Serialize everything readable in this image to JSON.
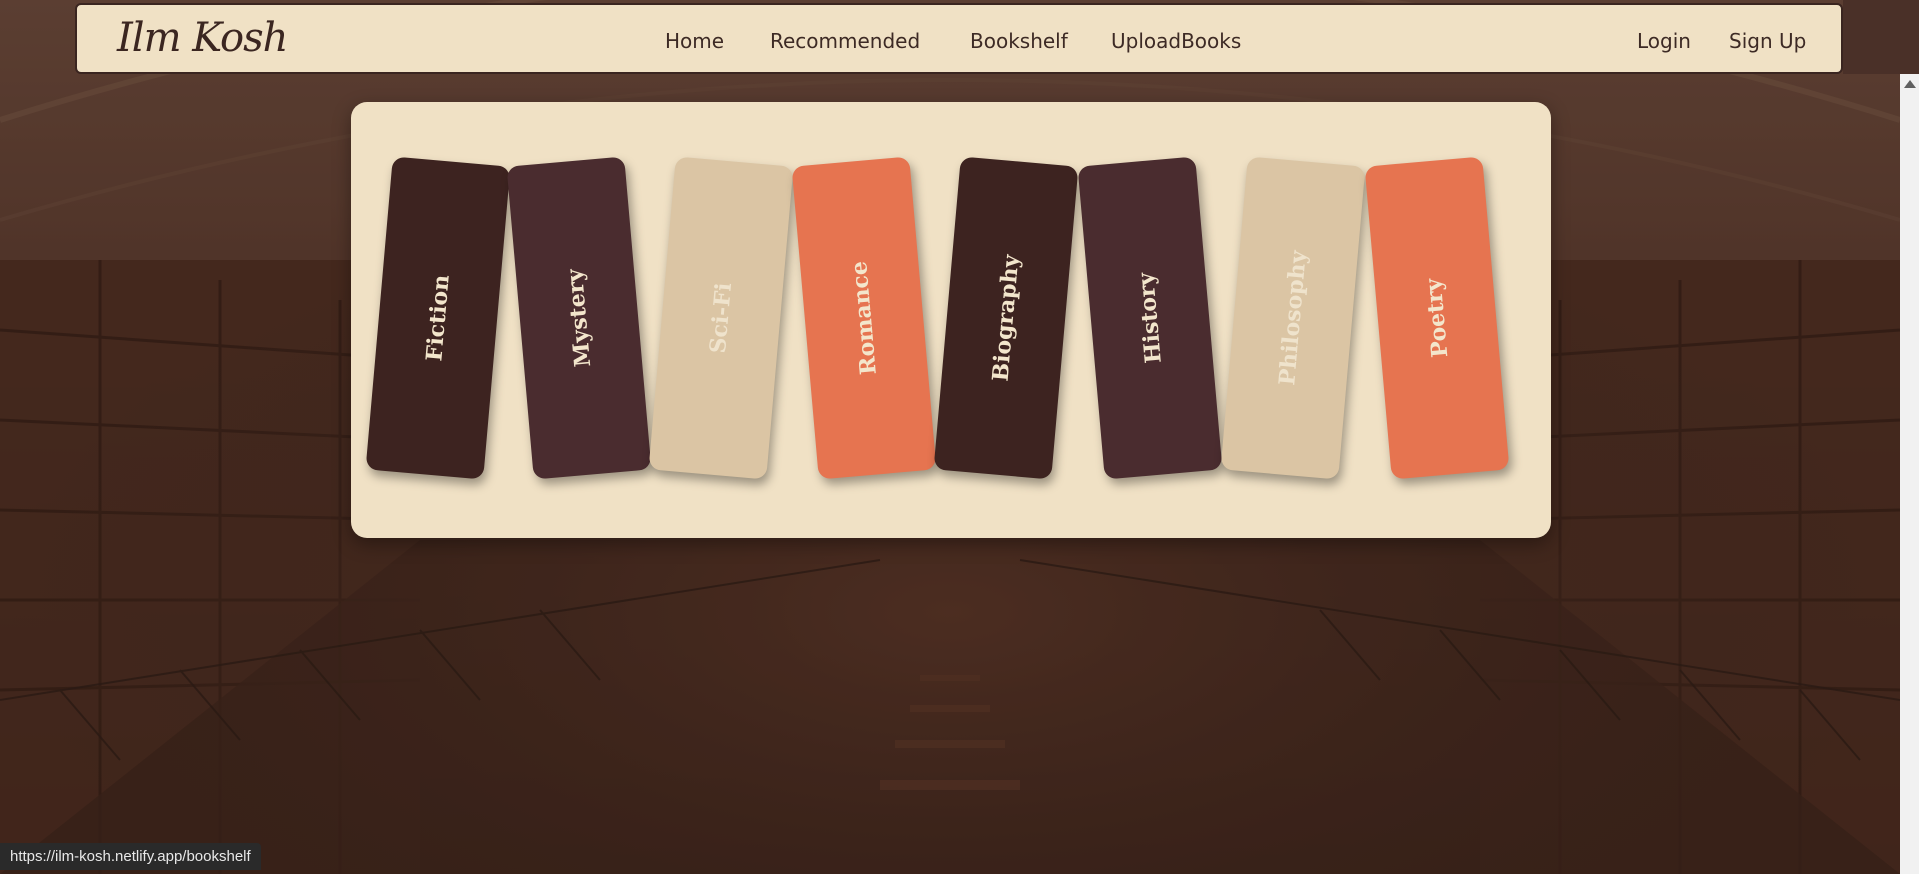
{
  "brand": {
    "logo": "Ilm Kosh"
  },
  "nav": {
    "home": "Home",
    "recommended": "Recommended",
    "bookshelf": "Bookshelf",
    "upload": "UploadBooks",
    "login": "Login",
    "signup": "Sign Up"
  },
  "genres": [
    {
      "label": "Fiction",
      "color": "#3d2320"
    },
    {
      "label": "Mystery",
      "color": "#4a2c2f"
    },
    {
      "label": "Sci-Fi",
      "color": "#dbc5a4"
    },
    {
      "label": "Romance",
      "color": "#e67450"
    },
    {
      "label": "Biography",
      "color": "#3d2320"
    },
    {
      "label": "History",
      "color": "#4a2c2f"
    },
    {
      "label": "Philosophy",
      "color": "#dbc5a4"
    },
    {
      "label": "Poetry",
      "color": "#e67450"
    }
  ],
  "status_url": "https://ilm-kosh.netlify.app/bookshelf",
  "colors": {
    "panel": "#f0e1c5",
    "dark_brown": "#3d2320",
    "plum_brown": "#4a2c2f",
    "beige": "#dbc5a4",
    "coral": "#e67450"
  }
}
